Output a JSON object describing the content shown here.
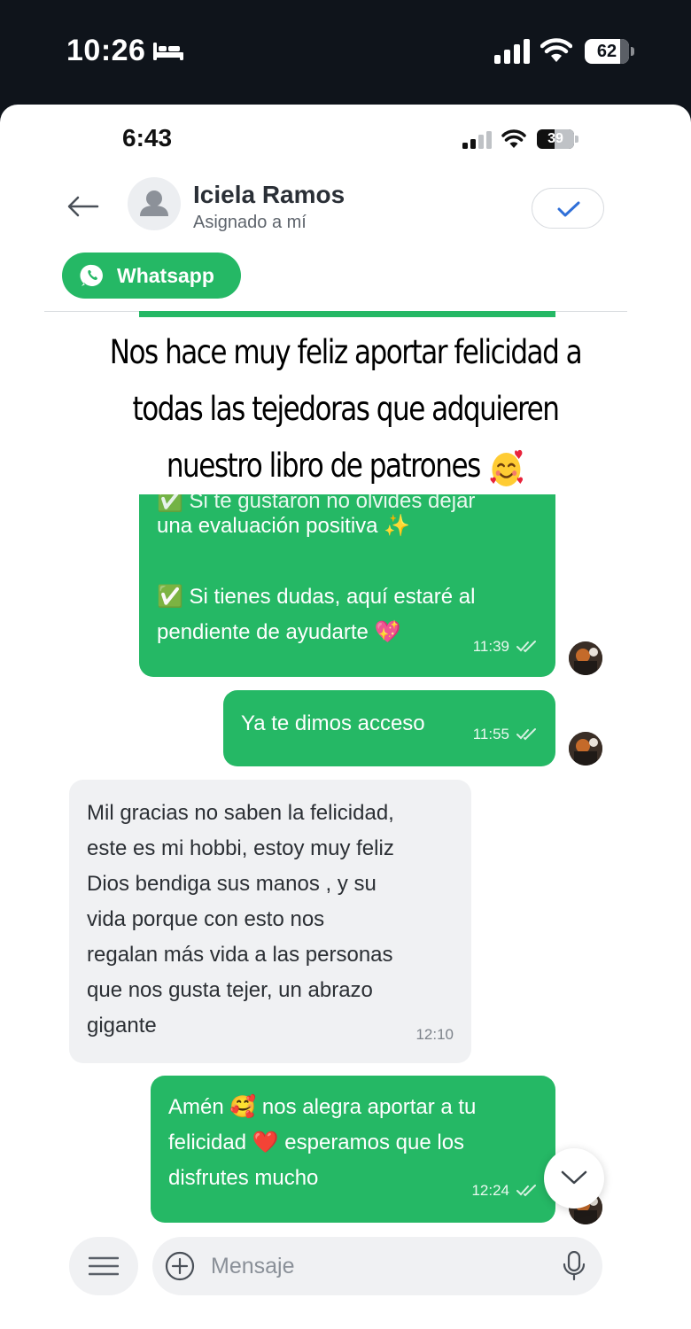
{
  "outer_status": {
    "time": "10:26",
    "battery": "62"
  },
  "inner_status": {
    "time": "6:43",
    "battery": "39"
  },
  "header": {
    "contact_name": "Iciela Ramos",
    "contact_status": "Asignado a mí"
  },
  "channel": {
    "label": "Whatsapp"
  },
  "overlay_caption": {
    "line1": "Nos hace muy feliz aportar felicidad a",
    "line2": "todas las tejedoras que adquieren",
    "line3": "nuestro libro de patrones"
  },
  "messages": [
    {
      "id": "m1",
      "direction": "out",
      "cut_line": "✅ Si te gustaron no olvides dejar",
      "text": "una evaluación positiva ✨\n\n✅ Si tienes dudas, aquí estaré al\npendiente de ayudarte 💖",
      "time": "11:39"
    },
    {
      "id": "m2",
      "direction": "out",
      "text": "Ya te dimos acceso",
      "time": "11:55"
    },
    {
      "id": "m3",
      "direction": "in",
      "text": "Mil gracias no saben la felicidad,\neste es mi hobbi, estoy muy feliz\nDios bendiga sus manos , y su\nvida porque con esto nos\nregalan más vida a las personas\nque nos gusta tejer, un abrazo\ngigante",
      "time": "12:10"
    },
    {
      "id": "m4",
      "direction": "out",
      "text": "Amén 🥰 nos alegra aportar a tu\nfelicidad ❤️ esperamos que los\ndisfrutes mucho",
      "time": "12:24"
    }
  ],
  "composer": {
    "placeholder": "Mensaje"
  },
  "colors": {
    "accent_green": "#25b865",
    "incoming_bubble": "#f0f1f3",
    "status_bar_bg": "#0f141b"
  },
  "icons": [
    "bed-icon",
    "cellular-signal-icon",
    "wifi-icon",
    "battery-icon",
    "back-arrow-icon",
    "user-avatar-icon",
    "checkmark-icon",
    "whatsapp-icon",
    "double-check-icon",
    "chevron-down-icon",
    "hamburger-menu-icon",
    "plus-circle-icon",
    "microphone-icon"
  ]
}
